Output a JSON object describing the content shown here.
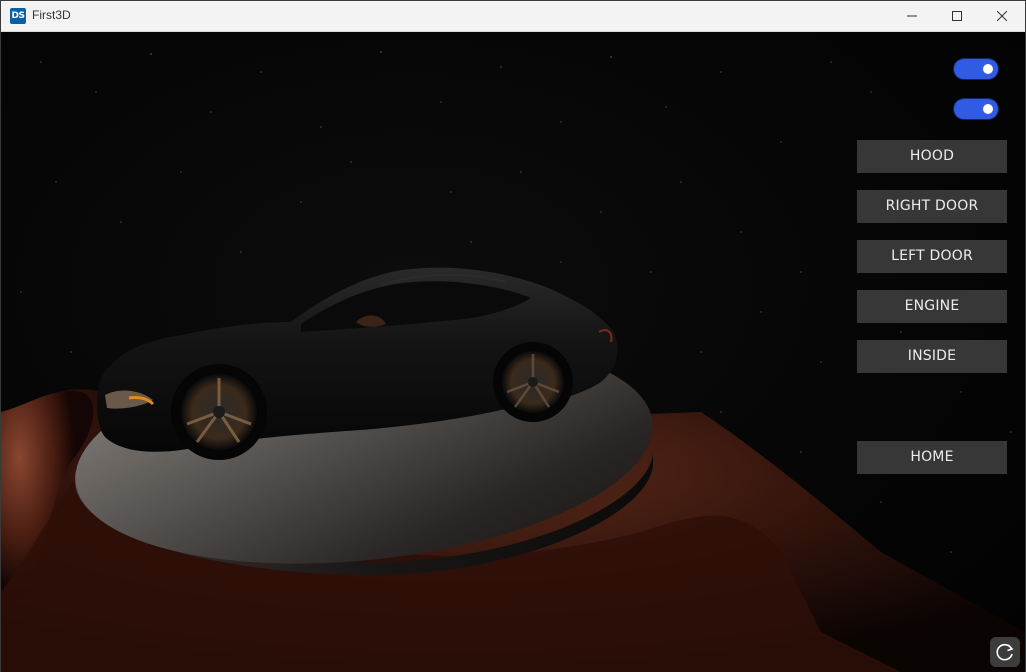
{
  "window": {
    "title": "First3D",
    "logo_text": "DS",
    "controls": [
      "minimize",
      "maximize",
      "close"
    ]
  },
  "toggles": [
    {
      "name": "toggle-1",
      "state": "on"
    },
    {
      "name": "toggle-2",
      "state": "on"
    }
  ],
  "buttons": {
    "hood": "HOOD",
    "right_door": "RIGHT DOOR",
    "left_door": "LEFT DOOR",
    "engine": "ENGINE",
    "inside": "INSIDE",
    "home": "HOME"
  },
  "icons": {
    "refresh": "refresh-icon"
  },
  "colors": {
    "toggle_on": "#2f5be5",
    "button_bg": "#3c3c3c",
    "button_text": "#ececec",
    "background": "#000000"
  }
}
